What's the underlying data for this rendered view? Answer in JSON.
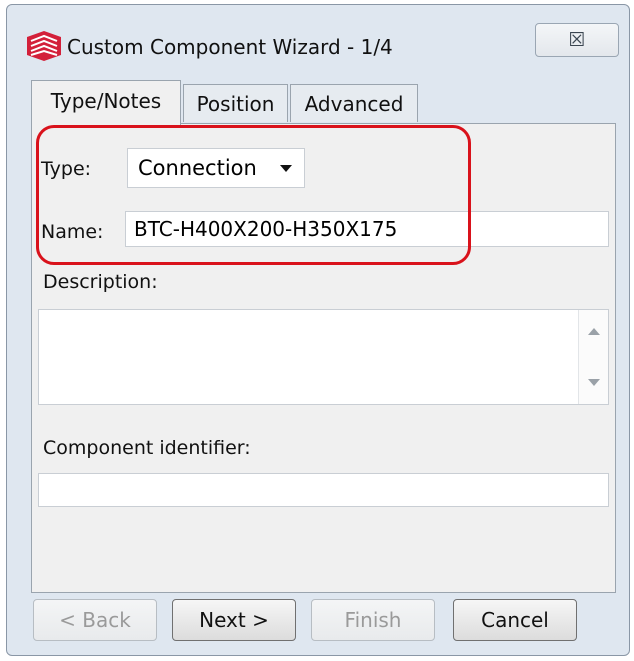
{
  "window": {
    "title": "Custom Component Wizard - 1/4",
    "close_glyph": "☒",
    "app_icon": "tekla-logo-icon"
  },
  "tabs": [
    {
      "label": "Type/Notes",
      "active": true
    },
    {
      "label": "Position",
      "active": false
    },
    {
      "label": "Advanced",
      "active": false
    }
  ],
  "form": {
    "type_label": "Type:",
    "type_value": "Connection",
    "name_label": "Name:",
    "name_value": "BTC-H400X200-H350X175",
    "description_label": "Description:",
    "description_value": "",
    "identifier_label": "Component identifier:",
    "identifier_value": ""
  },
  "buttons": {
    "back": "< Back",
    "next": "Next >",
    "finish": "Finish",
    "cancel": "Cancel"
  },
  "colors": {
    "highlight": "#d9121b",
    "window_bg": "#dfe7f0",
    "panel_bg": "#f0f0f0"
  }
}
